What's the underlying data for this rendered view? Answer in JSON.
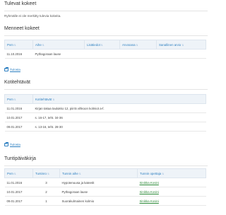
{
  "upcoming": {
    "title": "Tulevat kokeet",
    "empty_text": "Ryhmälle ei ole merkitty tulevia kokeita."
  },
  "past_exams": {
    "title": "Menneet kokeet",
    "columns": [
      "Pvm",
      "Aihe",
      "Lisätiedot",
      "Arvosana",
      "Sanallinen arvio"
    ],
    "rows": [
      {
        "date": "11.10.2016",
        "topic": "Pythagoraan lause",
        "info": "",
        "grade": "",
        "verbal": ""
      }
    ],
    "print_label": "Tulosta"
  },
  "homework": {
    "title": "Kotitehtävät",
    "columns": [
      "Pvm",
      "Kotitehtävät"
    ],
    "rows": [
      {
        "date": "11.01.2016",
        "task": "Kirjan takaa taulukko 12, piirrä vihkoon kolmiot a-f."
      },
      {
        "date": "10.01.2017",
        "task": "s. 16-17, teht. 34-36"
      },
      {
        "date": "09.01.2017",
        "task": "s. 13-16, teht. 28-30"
      }
    ],
    "print_label": "Tulosta"
  },
  "diary": {
    "title": "Tuntipäiväkirja",
    "columns": [
      "Pvm",
      "Tuntinro",
      "Tunnin aihe",
      "Tunnin opettaja"
    ],
    "rows": [
      {
        "date": "11.01.2016",
        "lesson": "3",
        "topic": "Hypotenuusa ja kateetit",
        "teacher": "Sinikka Kosini"
      },
      {
        "date": "10.01.2017",
        "lesson": "2",
        "topic": "Pythagoraan lause",
        "teacher": "Sinikka Kosini"
      },
      {
        "date": "09.01.2017",
        "lesson": "1",
        "topic": "Suorakulmainen kolmio",
        "teacher": "Sinikka Kosini"
      }
    ]
  },
  "colors": {
    "link_blue": "#2f80c1",
    "link_green": "#2e8b3a",
    "header_bg": "#eef3f8"
  }
}
